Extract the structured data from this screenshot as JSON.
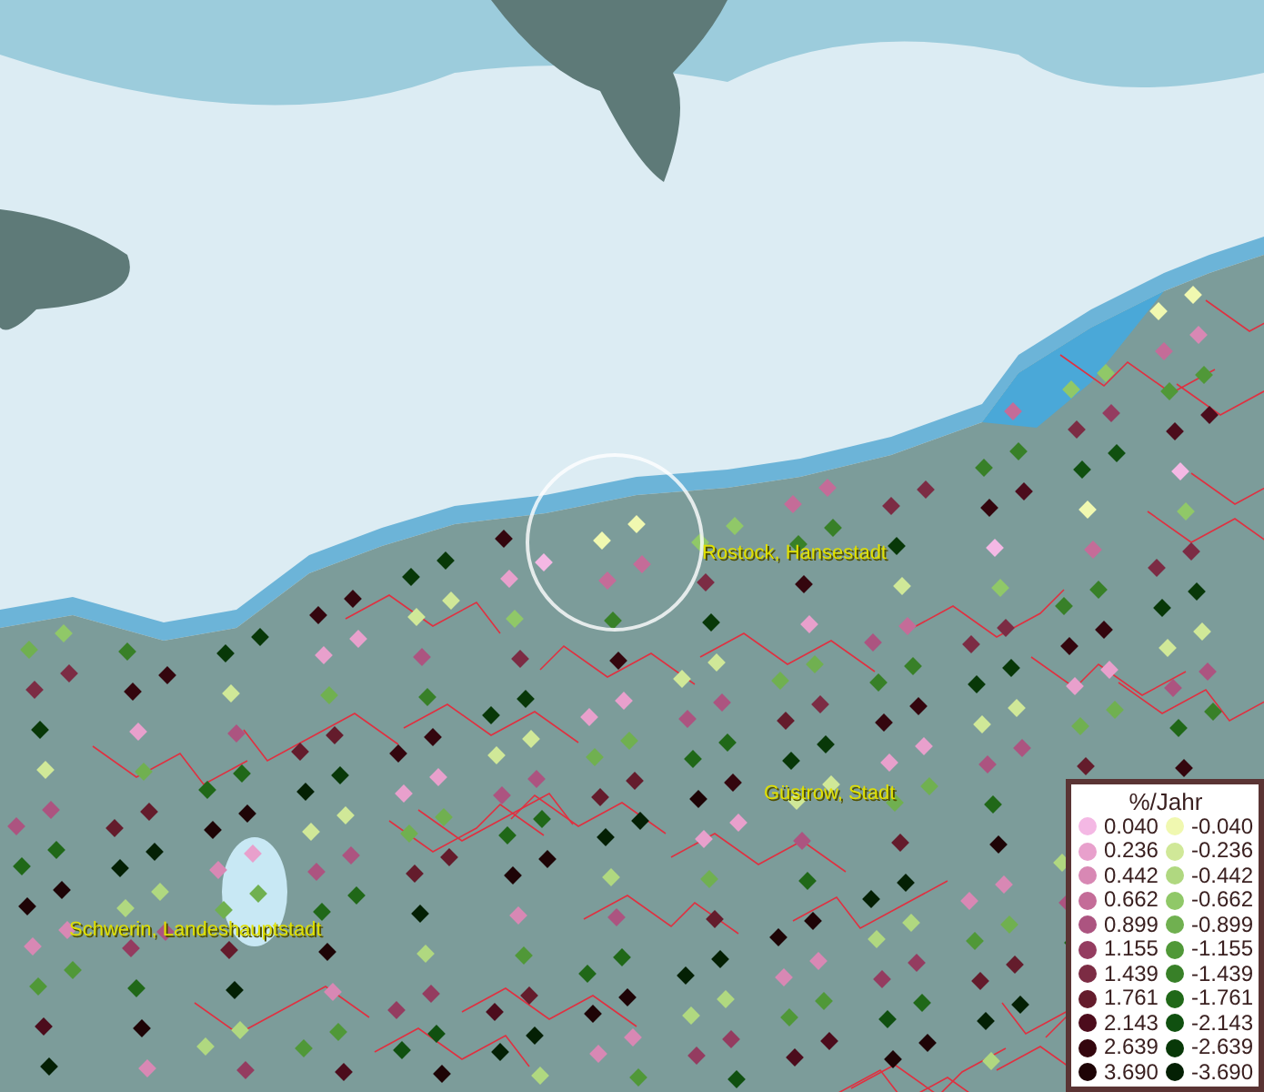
{
  "cities": [
    {
      "name": "Rostock, Hansestadt"
    },
    {
      "name": "Güstrow, Stadt"
    },
    {
      "name": "Schwerin, Landeshauptstadt"
    }
  ],
  "legend": {
    "title": "%/Jahr",
    "positive": [
      {
        "label": "0.040",
        "color": "#f4b8e4"
      },
      {
        "label": "0.236",
        "color": "#e8a0cc"
      },
      {
        "label": "0.442",
        "color": "#d888b4"
      },
      {
        "label": "0.662",
        "color": "#c46c98"
      },
      {
        "label": "0.899",
        "color": "#ac5480"
      },
      {
        "label": "1.155",
        "color": "#943c60"
      },
      {
        "label": "1.439",
        "color": "#7c2c44"
      },
      {
        "label": "1.761",
        "color": "#641c2c"
      },
      {
        "label": "2.143",
        "color": "#4c0c1c"
      },
      {
        "label": "2.639",
        "color": "#34060e"
      },
      {
        "label": "3.690",
        "color": "#1e0406"
      }
    ],
    "negative": [
      {
        "label": "-0.040",
        "color": "#f0f8b0"
      },
      {
        "label": "-0.236",
        "color": "#d0e898"
      },
      {
        "label": "-0.442",
        "color": "#b0d880"
      },
      {
        "label": "-0.662",
        "color": "#90c868"
      },
      {
        "label": "-0.899",
        "color": "#70b050"
      },
      {
        "label": "-1.155",
        "color": "#509838"
      },
      {
        "label": "-1.439",
        "color": "#388028"
      },
      {
        "label": "-1.761",
        "color": "#206818"
      },
      {
        "label": "-2.143",
        "color": "#105010"
      },
      {
        "label": "-2.639",
        "color": "#083808"
      },
      {
        "label": "-3.690",
        "color": "#042004"
      }
    ]
  }
}
